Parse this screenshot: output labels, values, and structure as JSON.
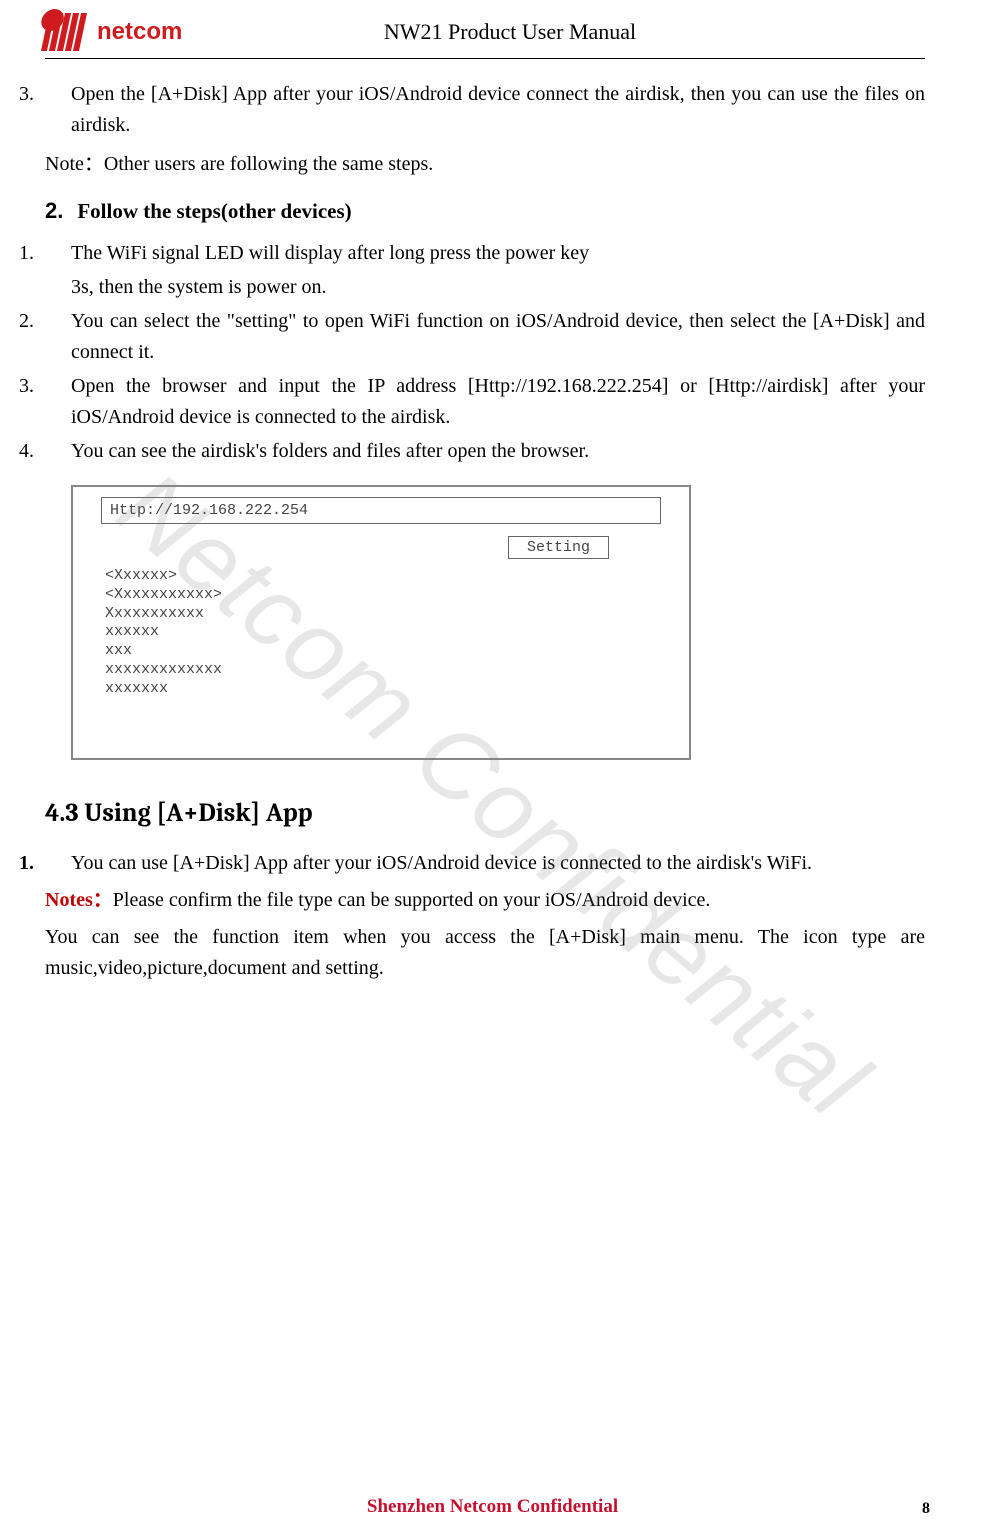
{
  "header": {
    "logo_text": "netcom",
    "title": "NW21 Product User Manual"
  },
  "top_list": {
    "item3_num": "3.",
    "item3": "Open the [A+Disk] App after your iOS/Android device connect the airdisk, then you can use the files on airdisk.",
    "note": "Note：Other users are following the same steps."
  },
  "section2": {
    "num": "2.",
    "title": "Follow the steps(other devices)",
    "s1_num": "1.",
    "s1a": "The WiFi signal LED will display after long press the power key",
    "s1b": "3s, then the system is power on.",
    "s2_num": "2.",
    "s2": "You can select the \"setting\" to open WiFi function on iOS/Android device, then select the [A+Disk] and connect it.",
    "s3_num": "3.",
    "s3": "Open the browser and input the IP address [Http://192.168.222.254] or [Http://airdisk] after your iOS/Android device is connected to the airdisk.",
    "s4_num": "4.",
    "s4": "You can see the airdisk's folders and files after open the browser."
  },
  "browser": {
    "url": "Http://192.168.222.254",
    "setting": "Setting",
    "lines": [
      "<Xxxxxx>",
      "<Xxxxxxxxxxx>",
      "Xxxxxxxxxxx",
      "xxxxxx",
      "xxx",
      "xxxxxxxxxxxxx",
      "xxxxxxx"
    ]
  },
  "section43": {
    "title": "4.3 Using [A+Disk] App",
    "p1_num": "1.",
    "p1": "You can use [A+Disk] App after your iOS/Android device is connected to the airdisk's WiFi.",
    "notes_label": "Notes：",
    "notes": "Please confirm the file type can be supported on your iOS/Android device.",
    "p2": "You can see the function item when you access the [A+Disk] main menu. The icon type are music,video,picture,document and setting."
  },
  "watermark": "Netcom Confidential",
  "footer": "Shenzhen Netcom Confidential",
  "page_number": "8"
}
